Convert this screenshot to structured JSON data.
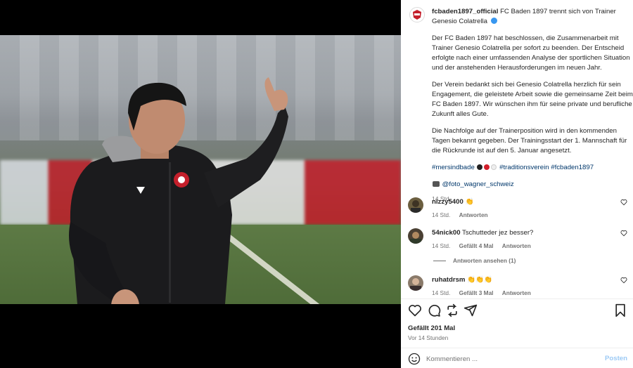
{
  "post": {
    "username": "fcbaden1897_official",
    "caption_title": "FC Baden 1897 trennt sich von Trainer Genesio Colatrella",
    "paragraphs": [
      "Der FC Baden 1897 hat beschlossen, die Zusammenarbeit mit Trainer Genesio Colatrella per sofort zu beenden. Der Entscheid erfolgte nach einer umfassenden Analyse der sportlichen Situation und der anstehenden Herausforderungen im neuen Jahr.",
      "Der Verein bedankt sich bei Genesio Colatrella herzlich für sein Engagement, die geleistete Arbeit sowie die gemeinsame Zeit beim FC Baden 1897. Wir wünschen ihm für seine private und berufliche Zukunft alles Gute.",
      "Die Nachfolge auf der Trainerposition wird in den kommenden Tagen bekannt gegeben. Der Trainingsstart der 1. Mannschaft für die Rückrunde ist auf den 5. Januar angesetzt."
    ],
    "hashtag_1": "#mersindbade",
    "hashtag_2": "#traditionsverein",
    "hashtag_3": "#fcbaden1897",
    "photo_credit": "@foto_wagner_schweiz",
    "time": "14 Std."
  },
  "comments": [
    {
      "user": "nizzy5400",
      "text": "👏",
      "time": "14 Std.",
      "likes": "",
      "reply": "Antworten"
    },
    {
      "user": "54nick00",
      "text": "Tschutteder jez besser?",
      "time": "14 Std.",
      "likes": "Gefällt 4 Mal",
      "reply": "Antworten"
    },
    {
      "user": "ruhatdrsm",
      "text": "👏👏👏",
      "time": "14 Std.",
      "likes": "Gefällt 3 Mal",
      "reply": "Antworten"
    }
  ],
  "view_replies": "Antworten ansehen (1)",
  "likes": "Gefällt 201 Mal",
  "posted_ago": "Vor 14 Stunden",
  "comment_input": {
    "placeholder": "Kommentieren ...",
    "post_label": "Posten"
  },
  "icons": {
    "like": "heart-icon",
    "comment": "comment-icon",
    "repost": "repost-icon",
    "share": "share-icon",
    "save": "bookmark-icon",
    "emoji": "emoji-icon"
  },
  "colors": {
    "link": "#00376b",
    "muted": "#737373",
    "post_button": "#9ccaf5",
    "club_red": "#c41f2b"
  }
}
